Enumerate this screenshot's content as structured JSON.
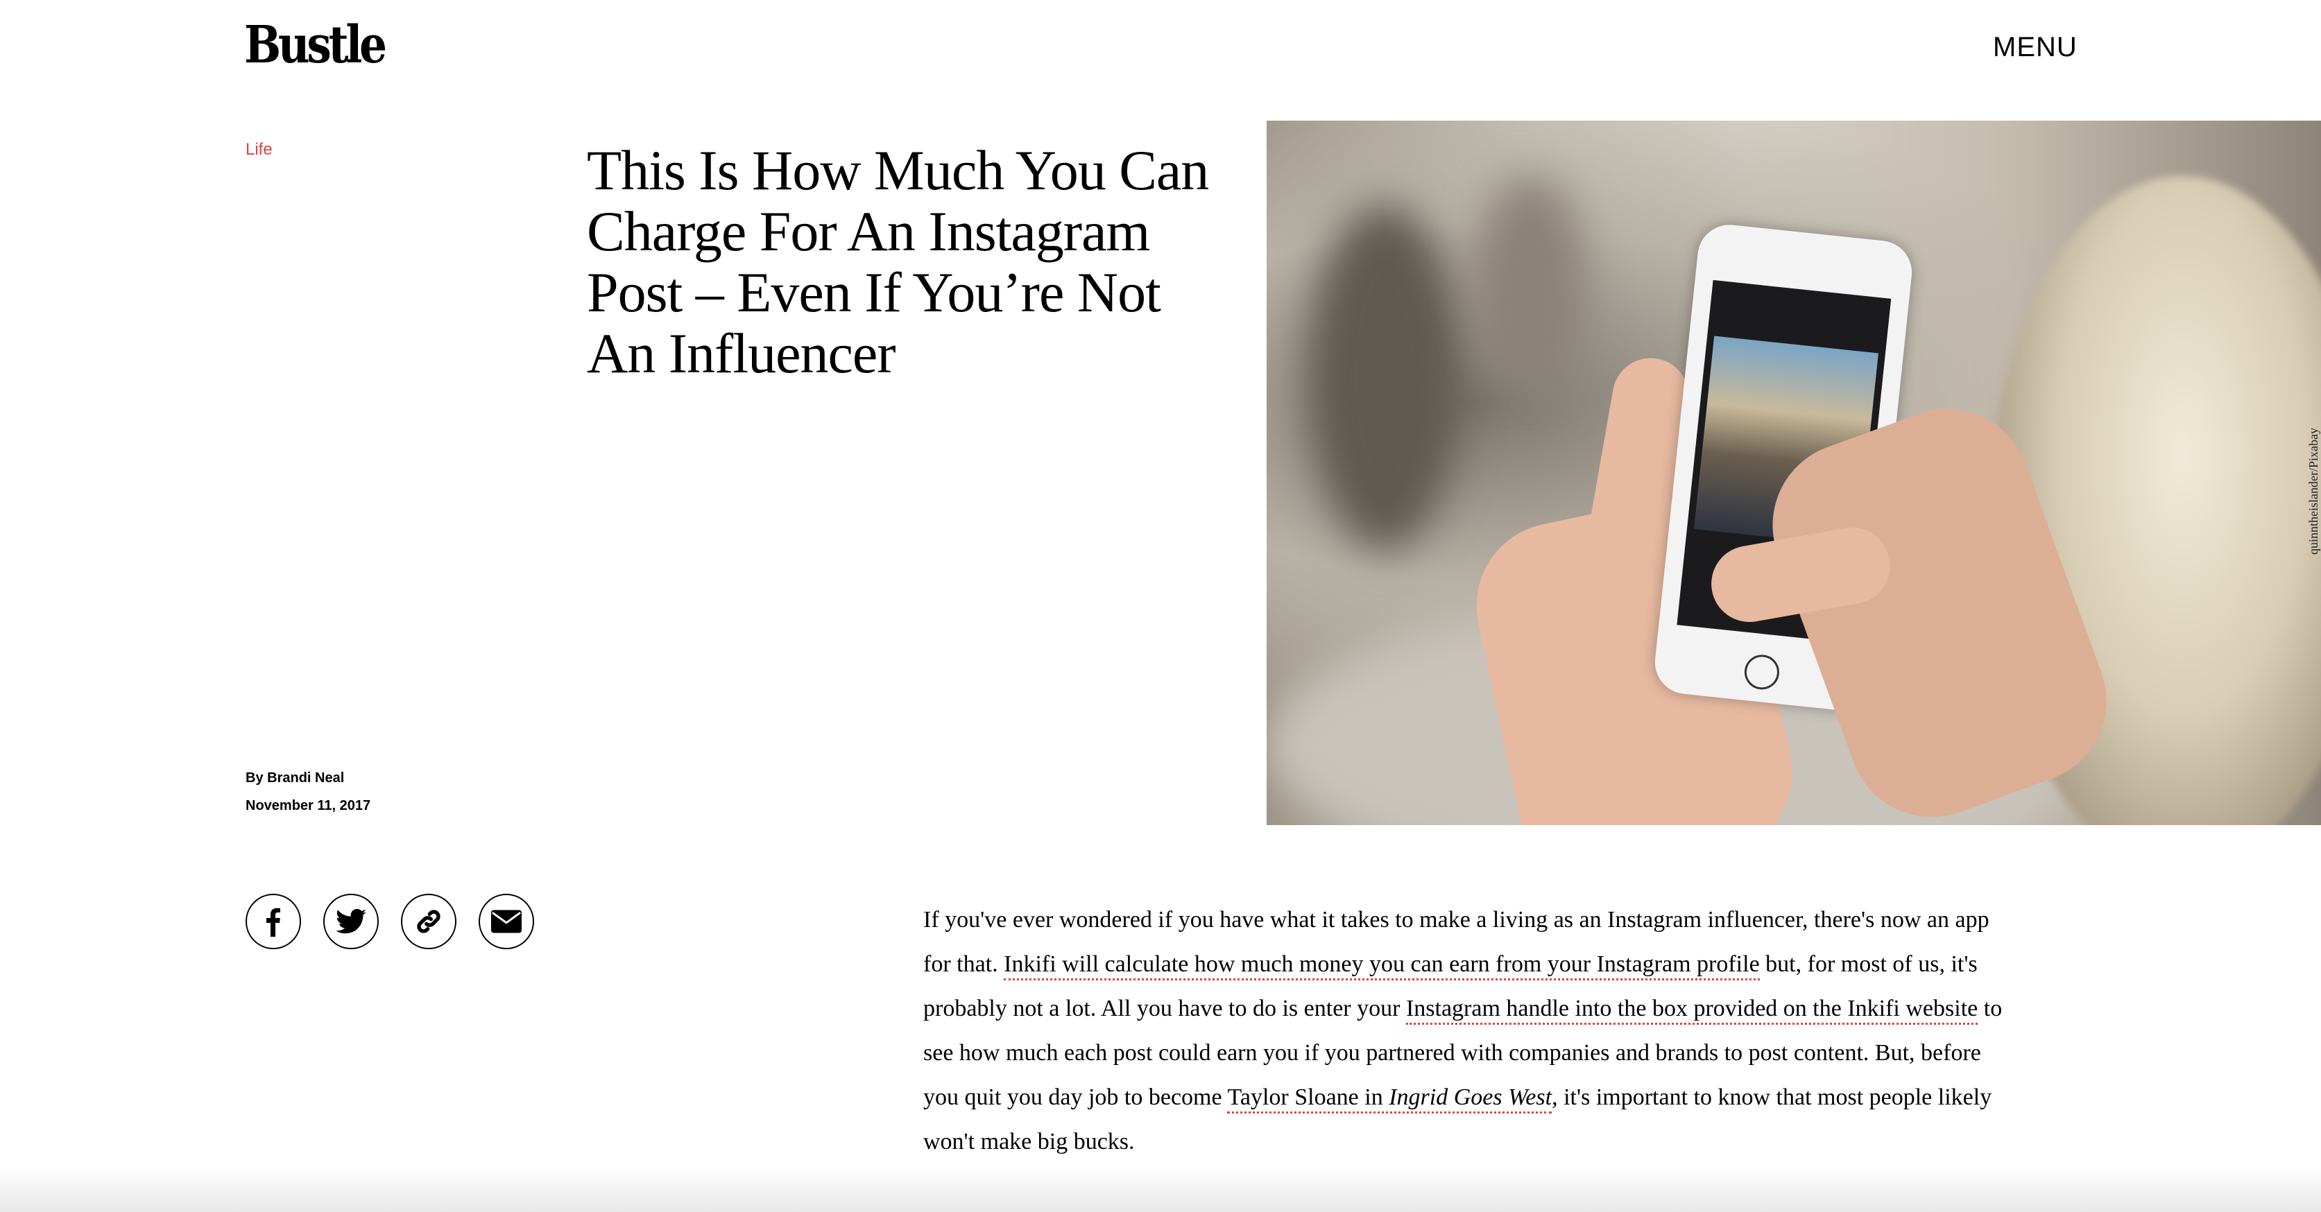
{
  "header": {
    "logo": "Bustle",
    "menu_label": "MENU"
  },
  "article": {
    "category": "Life",
    "title": "This Is How Much You Can Charge For An Instagram Post – Even If You’re Not An Influencer",
    "byline_prefix": "By",
    "author": "Brandi Neal",
    "date": "November 11, 2017",
    "image_credit": "quinntheislander/Pixabay",
    "share": [
      {
        "icon": "facebook-icon",
        "label": "facebook"
      },
      {
        "icon": "twitter-icon",
        "label": "twitter"
      },
      {
        "icon": "link-icon",
        "label": "copy link"
      },
      {
        "icon": "email-icon",
        "label": "email"
      }
    ],
    "body": {
      "t1": "If you've ever wondered if you have what it takes to make a living as an Instagram influencer, there's now an app for that. ",
      "link1": "Inkifi will calculate how much money you can earn from your Instagram profile",
      "t2": " but, for most of us, it's probably not a lot. All you have to do is enter your ",
      "link2": "Instagram handle into the box provided on the Inkifi website",
      "t3": " to see how much each post could earn you if you partnered with companies and brands to post content. But, before you quit you day job to become ",
      "link3_a": "Taylor Sloane in ",
      "link3_b": "Ingrid Goes West",
      "t4": ", it's important to know that most people likely won't make big bucks."
    }
  },
  "colors": {
    "accent": "#d9463c",
    "text": "#000000",
    "background": "#ffffff"
  }
}
